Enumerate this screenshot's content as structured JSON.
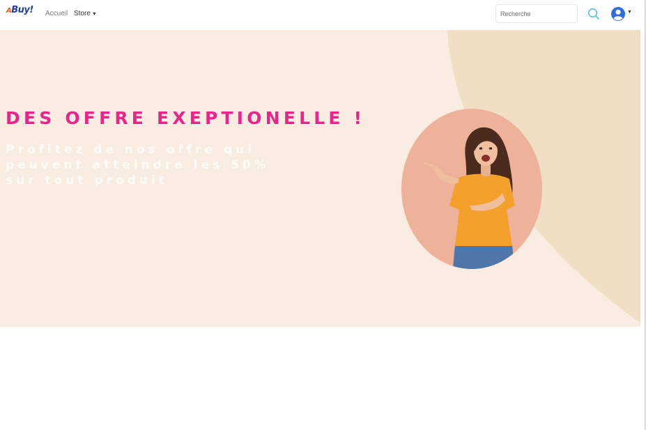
{
  "navbar": {
    "brand": "Buy!",
    "brand_prefix": "A",
    "links": [
      {
        "label": "Accueil"
      },
      {
        "label": "Store",
        "has_dropdown": true
      }
    ],
    "search": {
      "value": "",
      "placeholder": "Recherche",
      "icon": "search-icon"
    },
    "user": {
      "icon": "user-avatar-icon",
      "has_dropdown": true
    }
  },
  "hero": {
    "title": "DES OFFRE EXEPTIONELLE !",
    "subtitle": "Profitez de nos offre qui peuvent atteindre les 50% sur tout produit",
    "image": "woman-pointing-photo"
  },
  "colors": {
    "brand_blue": "#1f3f99",
    "accent_pink": "#e9248a",
    "hero_bg": "#f8ede0",
    "hero_curve": "#f1dfc5",
    "image_circle": "#eeb199",
    "search_icon": "#56c3d6",
    "user_icon": "#2f6edb"
  }
}
